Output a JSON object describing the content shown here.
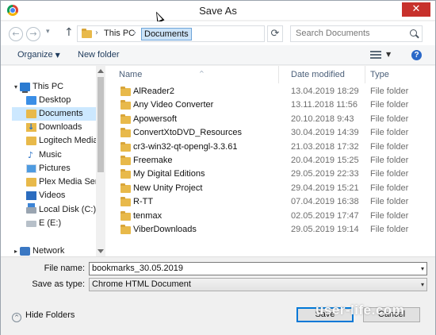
{
  "window": {
    "title": "Save As",
    "close_glyph": "✕",
    "app_icon": "chrome-icon"
  },
  "navigation": {
    "back_glyph": "←",
    "forward_glyph": "→",
    "recent_glyph": "▾",
    "up_glyph": "↑",
    "refresh_glyph": "⟳",
    "breadcrumb": [
      "This PC",
      "Documents"
    ],
    "breadcrumb_separator": "›",
    "search_placeholder": "Search Documents"
  },
  "toolbar": {
    "organize_label": "Organize",
    "new_folder_label": "New folder",
    "help_glyph": "?"
  },
  "nav_pane": {
    "items": [
      {
        "label": "This PC",
        "icon": "computer-icon",
        "level": 0,
        "expander": "▾",
        "selected": false
      },
      {
        "label": "Desktop",
        "icon": "desktop-folder-icon",
        "level": 1,
        "selected": false
      },
      {
        "label": "Documents",
        "icon": "documents-folder-icon",
        "level": 1,
        "selected": true
      },
      {
        "label": "Downloads",
        "icon": "downloads-folder-icon",
        "level": 1,
        "selected": false
      },
      {
        "label": "Logitech Media",
        "icon": "folder-icon",
        "level": 1,
        "selected": false
      },
      {
        "label": "Music",
        "icon": "music-folder-icon",
        "level": 1,
        "selected": false
      },
      {
        "label": "Pictures",
        "icon": "pictures-folder-icon",
        "level": 1,
        "selected": false
      },
      {
        "label": "Plex Media Serve",
        "icon": "folder-icon",
        "level": 1,
        "selected": false
      },
      {
        "label": "Videos",
        "icon": "videos-folder-icon",
        "level": 1,
        "selected": false
      },
      {
        "label": "Local Disk (C:)",
        "icon": "local-disk-icon",
        "level": 1,
        "selected": false
      },
      {
        "label": "E (E:)",
        "icon": "drive-icon",
        "level": 1,
        "selected": false
      },
      {
        "label": "Network",
        "icon": "network-icon",
        "level": 0,
        "expander": "▸",
        "selected": false
      }
    ]
  },
  "file_list": {
    "columns": [
      "Name",
      "Date modified",
      "Type"
    ],
    "sort_glyph": "^",
    "rows": [
      {
        "name": "AlReader2",
        "date": "13.04.2019 18:29",
        "type": "File folder"
      },
      {
        "name": "Any Video Converter",
        "date": "13.11.2018 11:56",
        "type": "File folder"
      },
      {
        "name": "Apowersoft",
        "date": "20.10.2018 9:43",
        "type": "File folder"
      },
      {
        "name": "ConvertXtoDVD_Resources",
        "date": "30.04.2019 14:39",
        "type": "File folder"
      },
      {
        "name": "cr3-win32-qt-opengl-3.3.61",
        "date": "21.03.2018 17:32",
        "type": "File folder"
      },
      {
        "name": "Freemake",
        "date": "20.04.2019 15:25",
        "type": "File folder"
      },
      {
        "name": "My Digital Editions",
        "date": "29.05.2019 22:33",
        "type": "File folder"
      },
      {
        "name": "New Unity Project",
        "date": "29.04.2019 15:21",
        "type": "File folder"
      },
      {
        "name": "R-TT",
        "date": "07.04.2019 16:38",
        "type": "File folder"
      },
      {
        "name": "tenmax",
        "date": "02.05.2019 17:47",
        "type": "File folder"
      },
      {
        "name": "ViberDownloads",
        "date": "29.05.2019 19:14",
        "type": "File folder"
      }
    ]
  },
  "save_form": {
    "file_name_label": "File name:",
    "file_name_value": "bookmarks_30.05.2019",
    "save_as_type_label": "Save as type:",
    "save_as_type_value": "Chrome HTML Document",
    "dropdown_glyph": "▾"
  },
  "footer": {
    "hide_folders_label": "Hide Folders",
    "hide_folders_glyph": "^",
    "save_label": "Save",
    "cancel_label": "Cancel",
    "watermark": "user-life.com"
  },
  "colors": {
    "close_button": "#c7312c",
    "selection": "#cce8ff",
    "folder": "#e8b94a",
    "link_text": "#1f3b5c"
  }
}
